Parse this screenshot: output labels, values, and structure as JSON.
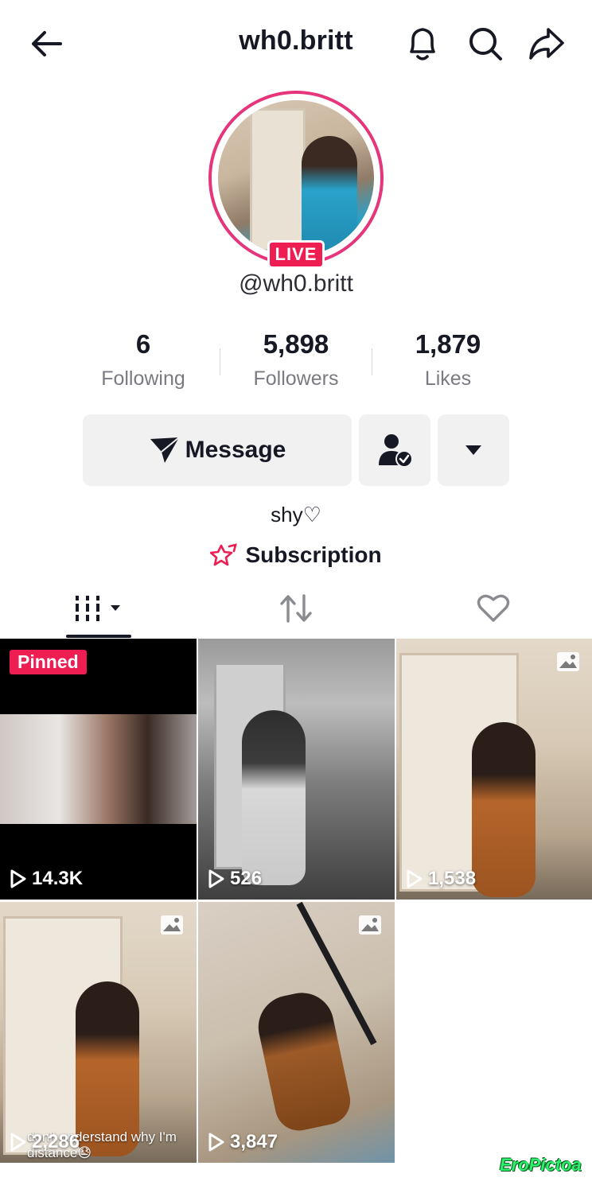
{
  "header": {
    "title": "wh0.britt",
    "back_icon": "arrow-left-icon",
    "notify_icon": "bell-icon",
    "search_icon": "search-icon",
    "share_icon": "share-arrow-icon"
  },
  "profile": {
    "live_label": "LIVE",
    "username": "@wh0.britt",
    "bio": "shy♡",
    "subscription_label": "Subscription",
    "accent_color": "#ee1d52"
  },
  "stats": [
    {
      "value": "6",
      "label": "Following"
    },
    {
      "value": "5,898",
      "label": "Followers"
    },
    {
      "value": "1,879",
      "label": "Likes"
    }
  ],
  "actions": {
    "message_label": "Message"
  },
  "tabs": [
    {
      "name": "videos",
      "icon": "grid-bars-icon",
      "active": true
    },
    {
      "name": "reposts",
      "icon": "repost-icon",
      "active": false
    },
    {
      "name": "liked",
      "icon": "heart-icon",
      "active": false
    }
  ],
  "videos": [
    {
      "views": "14.3K",
      "pinned_label": "Pinned",
      "type": "video"
    },
    {
      "views": "526",
      "type": "video"
    },
    {
      "views": "1,538",
      "type": "photo"
    },
    {
      "views": "2,286",
      "type": "photo",
      "caption": "don't understand why I'm distance😓"
    },
    {
      "views": "3,847",
      "type": "photo"
    }
  ],
  "watermark": "EroPictoa"
}
